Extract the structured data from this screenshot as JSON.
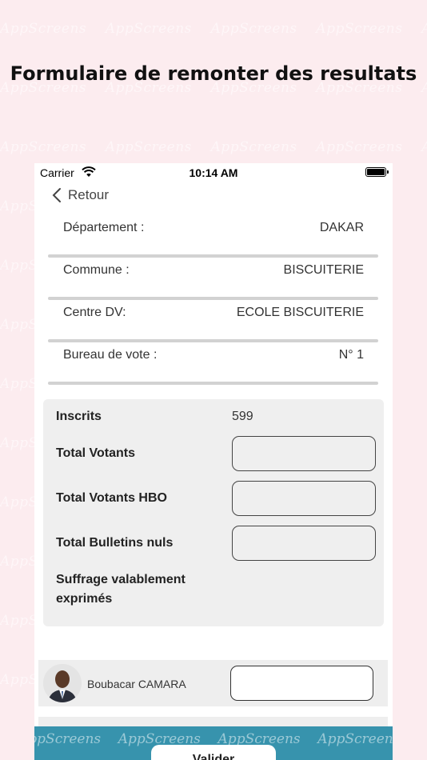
{
  "watermark": "AppScreens",
  "headline": "Formulaire de remonter des resultats",
  "status_bar": {
    "carrier": "Carrier",
    "time": "10:14 AM"
  },
  "nav": {
    "back_label": "Retour"
  },
  "info_rows": [
    {
      "label": "Département :",
      "value": "DAKAR"
    },
    {
      "label": "Commune :",
      "value": "BISCUITERIE"
    },
    {
      "label": "Centre DV:",
      "value": "ECOLE BISCUITERIE"
    },
    {
      "label": "Bureau de vote :",
      "value": "N° 1"
    }
  ],
  "results": {
    "inscrits_label": "Inscrits",
    "inscrits_value": "599",
    "total_votants_label": "Total Votants",
    "total_votants_value": "",
    "total_votants_hbo_label": "Total Votants HBO",
    "total_votants_hbo_value": "",
    "total_bulletins_nuls_label": "Total Bulletins nuls",
    "total_bulletins_nuls_value": "",
    "suffrage_label_line1": "Suffrage valablement",
    "suffrage_label_line2": "exprimés"
  },
  "candidates": [
    {
      "name": "Boubacar CAMARA",
      "votes": ""
    }
  ],
  "validate_label": "Valider"
}
